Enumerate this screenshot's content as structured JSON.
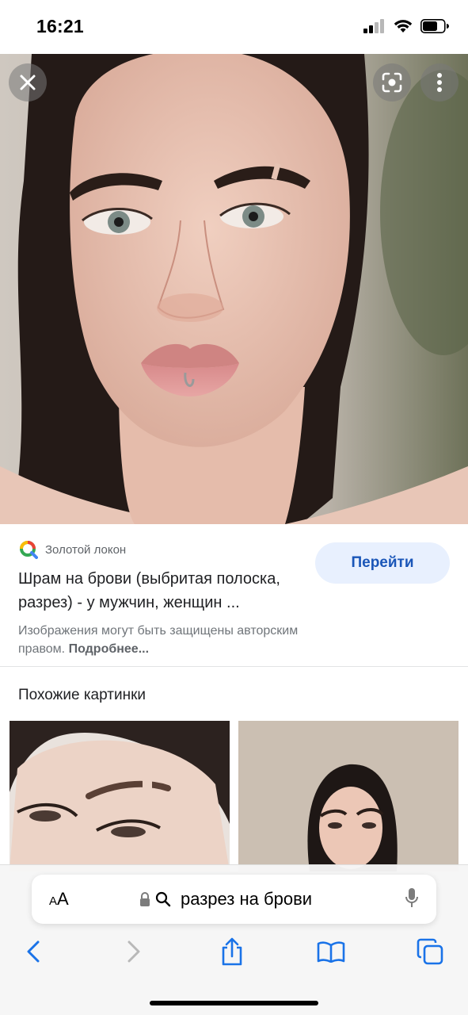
{
  "status_bar": {
    "time": "16:21",
    "icons": [
      "cellular-signal-icon",
      "wifi-icon",
      "battery-icon"
    ]
  },
  "viewer": {
    "close_icon": "close-icon",
    "lens_icon": "google-lens-icon",
    "more_icon": "more-vertical-icon"
  },
  "result": {
    "source_name": "Золотой локон",
    "title": "Шрам на брови (выбритая полоска, разрез) - у мужчин, женщин ...",
    "go_button": "Перейти",
    "copyright_text": "Изображения могут быть защищены авторским правом.",
    "copyright_link": "Подробнее..."
  },
  "similar": {
    "heading": "Похожие картинки"
  },
  "safari": {
    "aa_label_small": "A",
    "aa_label_large": "A",
    "url_text": "разрез на брови",
    "toolbar_icons": [
      "back-icon",
      "forward-icon",
      "share-icon",
      "bookmarks-icon",
      "tabs-icon"
    ]
  },
  "colors": {
    "accent": "#1a73e8",
    "go_button_bg": "#e8f0fe"
  }
}
